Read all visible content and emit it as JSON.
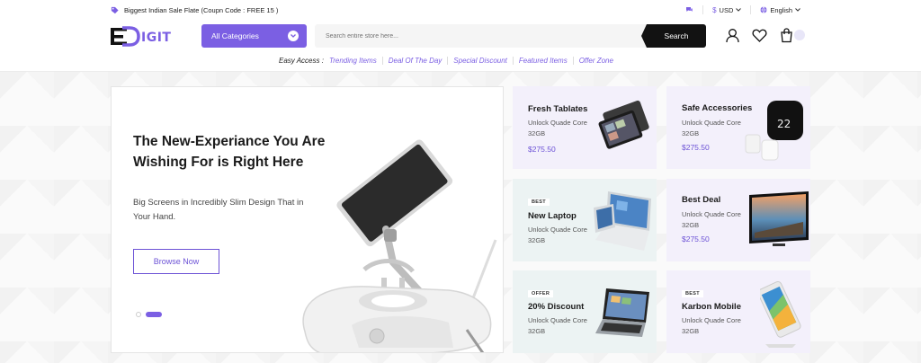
{
  "topbar": {
    "promo": "Biggest Indian Sale Flate (Coupn Code : FREE 15 )",
    "currency": "USD",
    "language": "English"
  },
  "header": {
    "category_label": "All Categories",
    "search_placeholder": "Search entire store here...",
    "search_button": "Search"
  },
  "easy_access": {
    "label": "Easy Access :",
    "links": [
      "Trending Items",
      "Deal Of The Day",
      "Special Discount",
      "Featured Items",
      "Offer Zone"
    ]
  },
  "hero": {
    "title": "The New-Experiance You Are Wishing For is Right Here",
    "subtitle": "Big Screens in Incredibly Slim Design That in Your Hand.",
    "button": "Browse Now"
  },
  "tiles": [
    {
      "badge": "",
      "title": "Fresh Tablates",
      "desc": "Unlock Quade Core 32GB",
      "price": "$275.50"
    },
    {
      "badge": "",
      "title": "Safe Accessories",
      "desc": "Unlock Quade Core 32GB",
      "price": "$275.50"
    },
    {
      "badge": "BEST",
      "title": "New Laptop",
      "desc": "Unlock Quade Core 32GB",
      "price": ""
    },
    {
      "badge": "",
      "title": "Best Deal",
      "desc": "Unlock Quade Core 32GB",
      "price": "$275.50"
    },
    {
      "badge": "OFFER",
      "title": "20% Discount",
      "desc": "Unlock Quade Core 32GB",
      "price": ""
    },
    {
      "badge": "BEST",
      "title": "Karbon Mobile",
      "desc": "Unlock Quade Core 32GB",
      "price": ""
    }
  ],
  "colors": {
    "accent": "#7b5fe3",
    "dark": "#121212",
    "tile_lavender": "#f3f0fb",
    "tile_mint": "#ecf3f3"
  },
  "icons": [
    "tag-icon",
    "chat-icon",
    "dollar-icon",
    "globe-icon",
    "chevron-down-icon",
    "user-icon",
    "heart-icon",
    "cart-icon"
  ]
}
